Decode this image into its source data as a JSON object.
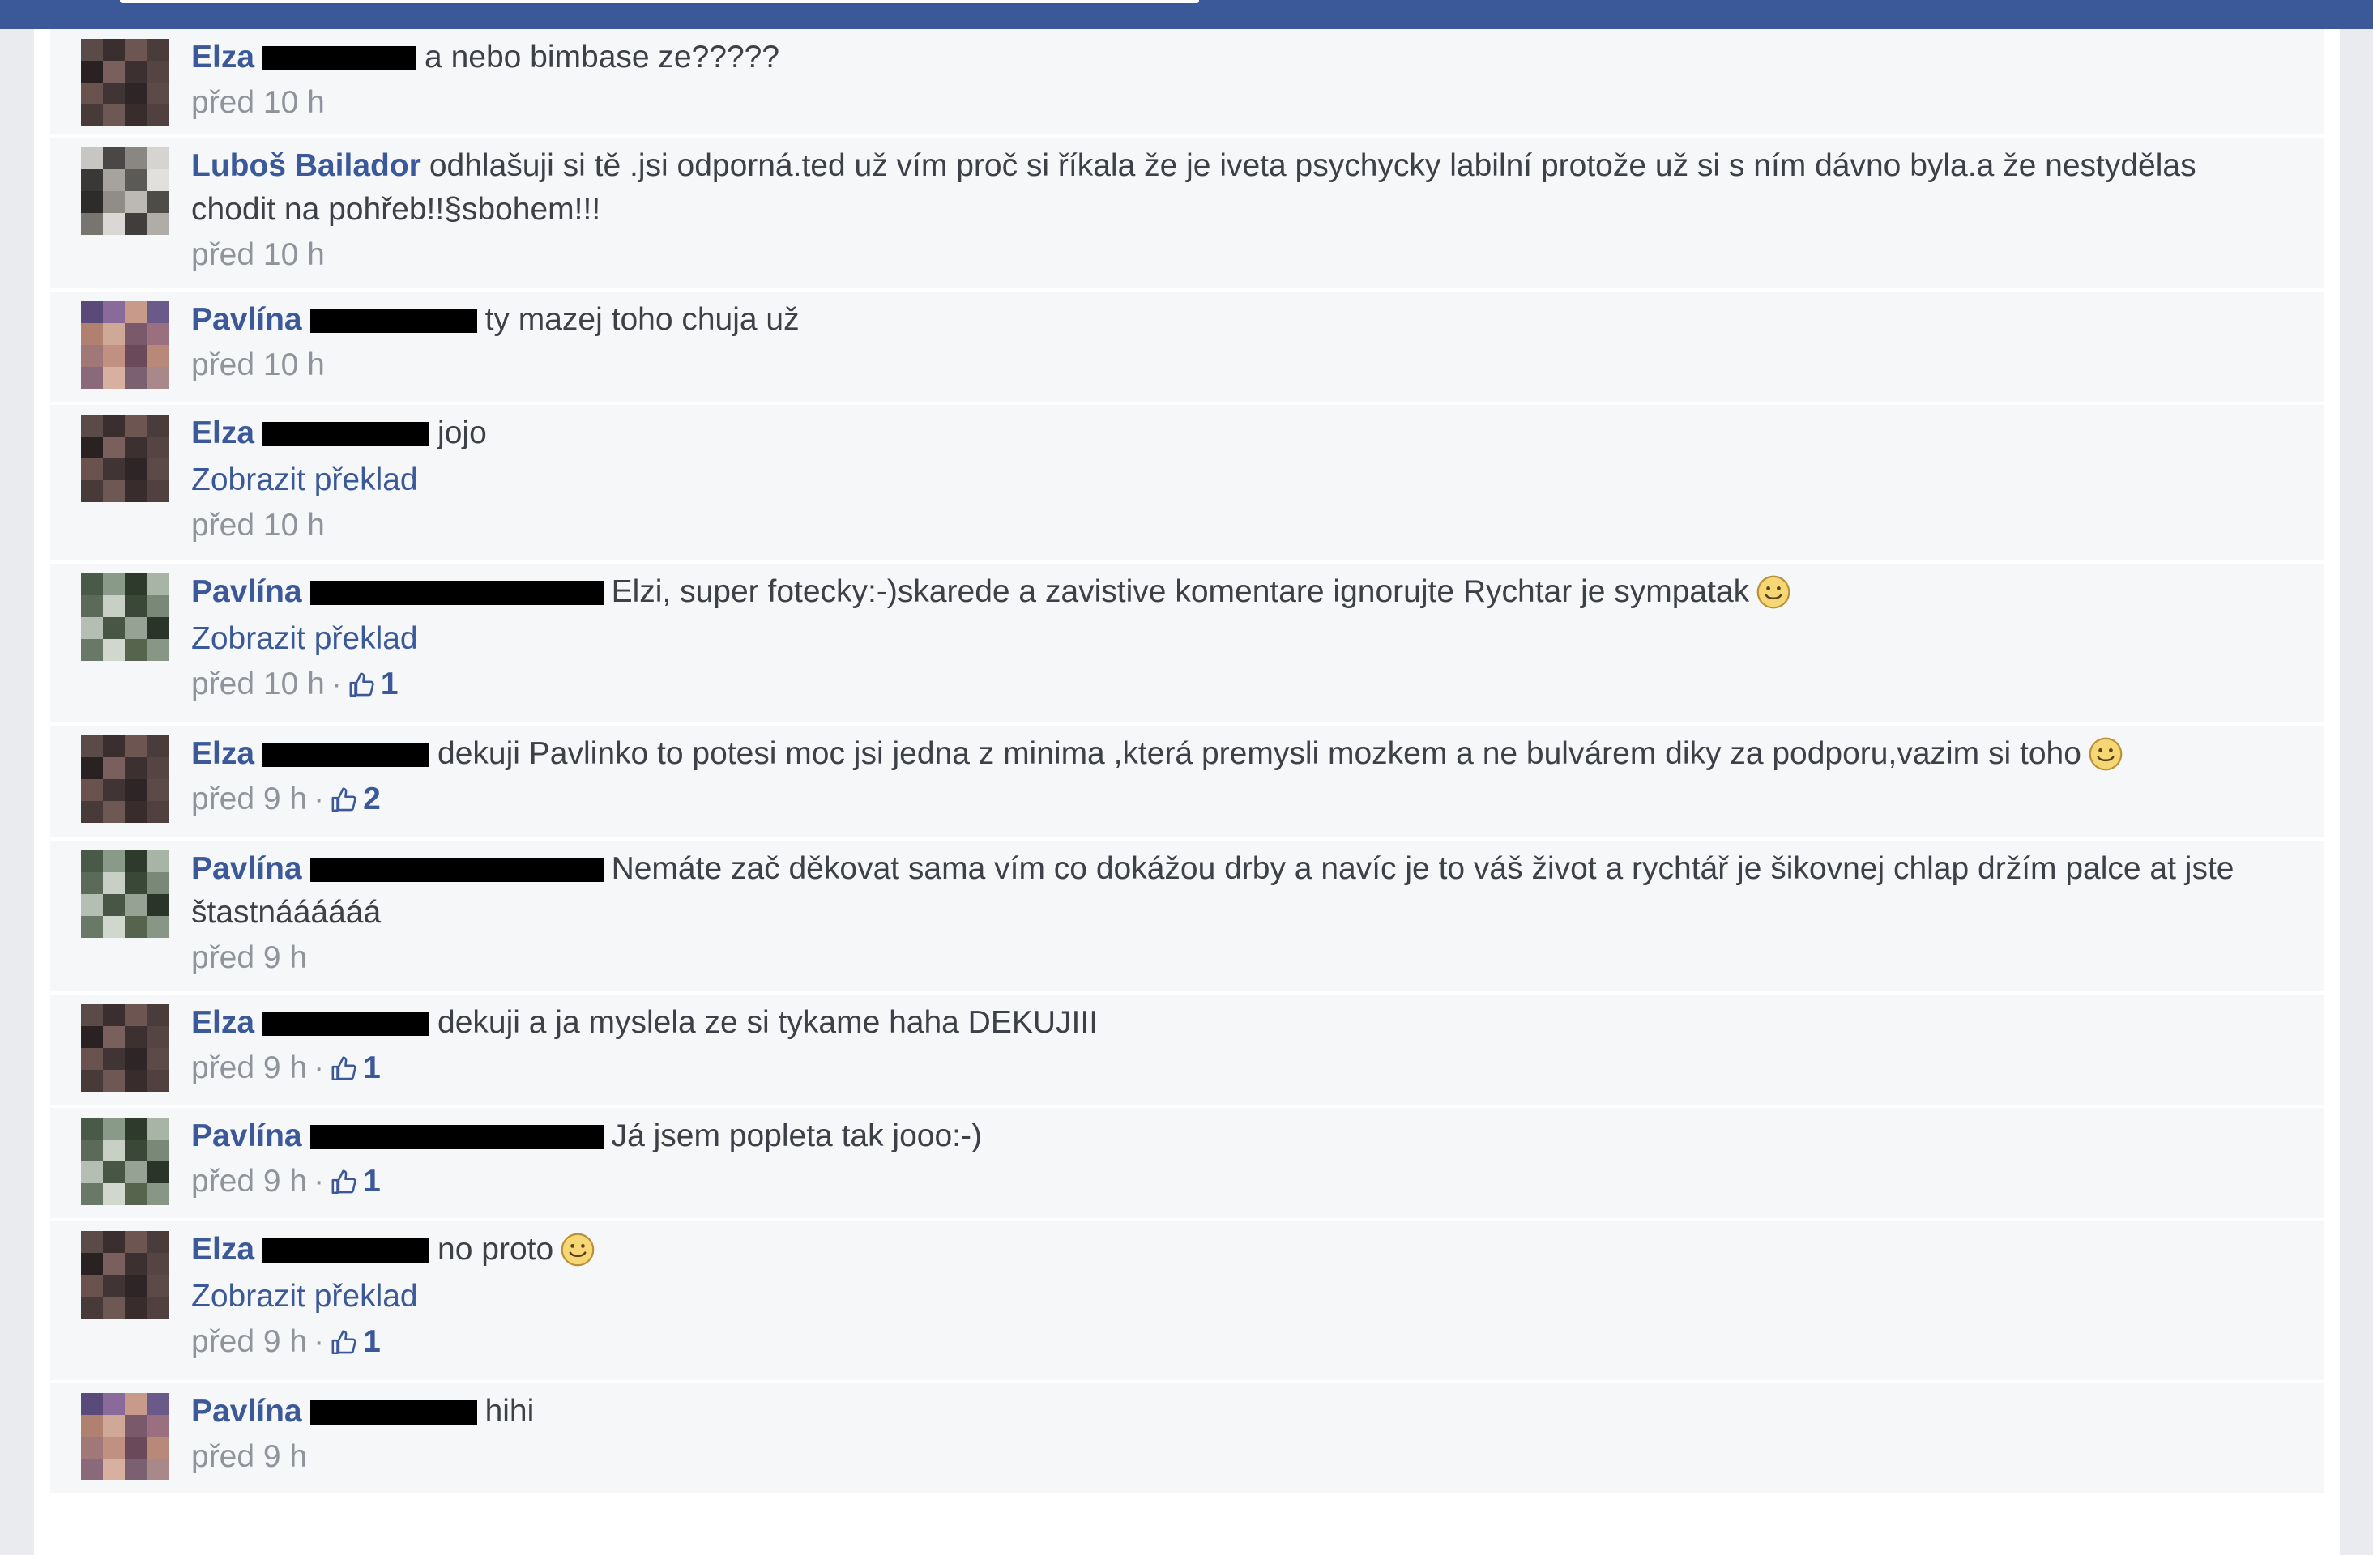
{
  "comments": [
    {
      "author": "Elza",
      "redact_w": 190,
      "text": "a nebo bimbase ze?????",
      "translate": "",
      "time": "před 10 h",
      "likes": "",
      "smiley": false,
      "avatar": "a"
    },
    {
      "author": "Luboš Bailador",
      "redact_w": 0,
      "text": "odhlašuji si tě .jsi odporná.ted už vím proč si říkala že je iveta psychycky labilní protože už si s ním dávno byla.a že nestydělas chodit na pohřeb!!§sbohem!!!",
      "translate": "",
      "time": "před 10 h",
      "likes": "",
      "smiley": false,
      "avatar": "b"
    },
    {
      "author": "Pavlína",
      "redact_w": 206,
      "text": "ty mazej toho chuja už",
      "translate": "",
      "time": "před 10 h",
      "likes": "",
      "smiley": false,
      "avatar": "c"
    },
    {
      "author": "Elza",
      "redact_w": 206,
      "text": "jojo",
      "translate": "Zobrazit překlad",
      "time": "před 10 h",
      "likes": "",
      "smiley": false,
      "avatar": "a"
    },
    {
      "author": "Pavlína",
      "redact_w": 362,
      "text": "Elzi, super fotecky:-)skarede a zavistive komentare ignorujte Rychtar je sympatak",
      "translate": "Zobrazit překlad",
      "time": "před 10 h",
      "likes": "1",
      "smiley": true,
      "avatar": "d"
    },
    {
      "author": "Elza",
      "redact_w": 206,
      "text": "dekuji Pavlinko to potesi moc jsi jedna z minima ,která premysli mozkem a ne bulvárem diky za podporu,vazim si toho",
      "translate": "",
      "time": "před 9 h",
      "likes": "2",
      "smiley": true,
      "avatar": "a"
    },
    {
      "author": "Pavlína",
      "redact_w": 362,
      "text": "Nemáte zač děkovat sama vím co dokážou drby a navíc je to váš život a rychtář je šikovnej chlap držím palce at jste štastnáááááá",
      "translate": "",
      "time": "před 9 h",
      "likes": "",
      "smiley": false,
      "avatar": "d"
    },
    {
      "author": "Elza",
      "redact_w": 206,
      "text": "dekuji a ja myslela ze si tykame haha DEKUJIII",
      "translate": "",
      "time": "před 9 h",
      "likes": "1",
      "smiley": false,
      "avatar": "a"
    },
    {
      "author": "Pavlína",
      "redact_w": 362,
      "text": "Já jsem popleta tak jooo:-)",
      "translate": "",
      "time": "před 9 h",
      "likes": "1",
      "smiley": false,
      "avatar": "d"
    },
    {
      "author": "Elza",
      "redact_w": 206,
      "text": "no proto",
      "translate": "Zobrazit překlad",
      "time": "před 9 h",
      "likes": "1",
      "smiley": true,
      "avatar": "a"
    },
    {
      "author": "Pavlína",
      "redact_w": 206,
      "text": "hihi",
      "translate": "",
      "time": "před 9 h",
      "likes": "",
      "smiley": false,
      "avatar": "c"
    }
  ],
  "colors": {
    "brand": "#3b5998",
    "meta": "#8f949c",
    "background": "#f6f7f9"
  },
  "icons": {
    "like": "thumbs-up-icon",
    "smiley": "smiley-emoji-icon"
  }
}
